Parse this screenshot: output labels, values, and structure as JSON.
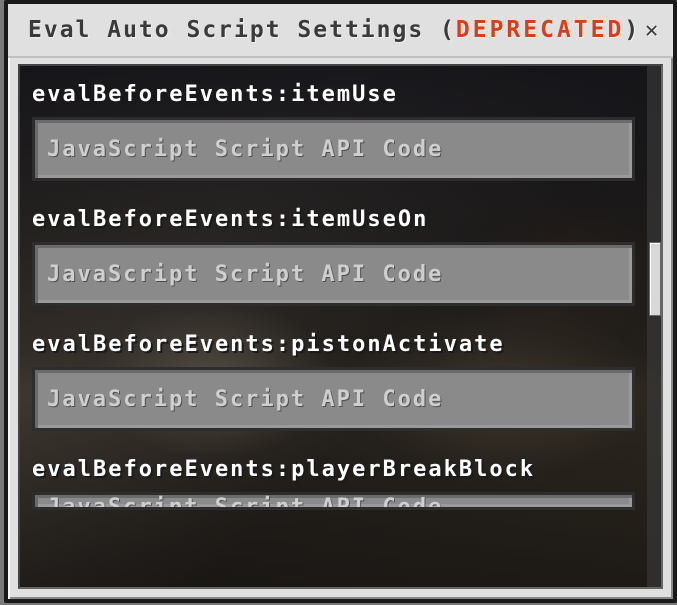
{
  "title": {
    "prefix": "Eval Auto Script Settings (",
    "deprecated": "DEPRECATED",
    "suffix": ")"
  },
  "close_symbol": "✕",
  "placeholder": "JavaScript Script API Code",
  "events": [
    {
      "label": "evalBeforeEvents:itemUse"
    },
    {
      "label": "evalBeforeEvents:itemUseOn"
    },
    {
      "label": "evalBeforeEvents:pistonActivate"
    },
    {
      "label": "evalBeforeEvents:playerBreakBlock"
    }
  ]
}
